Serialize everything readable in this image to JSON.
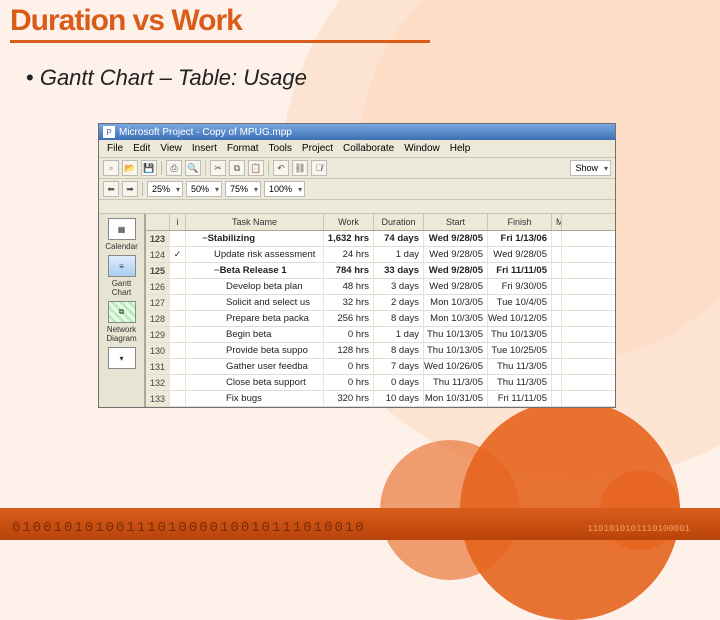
{
  "slide": {
    "title": "Duration vs Work",
    "bullet": "Gantt Chart – Table: Usage"
  },
  "app": {
    "title": "Microsoft Project - Copy of MPUG.mpp",
    "menu": [
      "File",
      "Edit",
      "View",
      "Insert",
      "Format",
      "Tools",
      "Project",
      "Collaborate",
      "Window",
      "Help"
    ],
    "zooms": [
      "25%",
      "50%",
      "75%",
      "100%"
    ],
    "show_label": "Show",
    "sidebar": [
      {
        "label": "Calendar"
      },
      {
        "label": "Gantt Chart"
      },
      {
        "label": "Network Diagram"
      }
    ],
    "columns": {
      "info": "i",
      "task": "Task Name",
      "work": "Work",
      "dur": "Duration",
      "start": "Start",
      "finish": "Finish",
      "m": "M"
    },
    "rows": [
      {
        "n": "123",
        "icon": "",
        "lvl": 1,
        "outline": true,
        "bold": true,
        "name": "Stabilizing",
        "work": "1,632 hrs",
        "dur": "74 days",
        "start": "Wed 9/28/05",
        "fin": "Fri 1/13/06"
      },
      {
        "n": "124",
        "icon": "✓",
        "lvl": 2,
        "name": "Update risk assessment",
        "work": "24 hrs",
        "dur": "1 day",
        "start": "Wed 9/28/05",
        "fin": "Wed 9/28/05"
      },
      {
        "n": "125",
        "icon": "",
        "lvl": 2,
        "outline": true,
        "bold": true,
        "name": "Beta Release 1",
        "work": "784 hrs",
        "dur": "33 days",
        "start": "Wed 9/28/05",
        "fin": "Fri 11/11/05"
      },
      {
        "n": "126",
        "icon": "",
        "lvl": 3,
        "name": "Develop beta plan",
        "work": "48 hrs",
        "dur": "3 days",
        "start": "Wed 9/28/05",
        "fin": "Fri 9/30/05"
      },
      {
        "n": "127",
        "icon": "",
        "lvl": 3,
        "name": "Solicit and select us",
        "work": "32 hrs",
        "dur": "2 days",
        "start": "Mon 10/3/05",
        "fin": "Tue 10/4/05"
      },
      {
        "n": "128",
        "icon": "",
        "lvl": 3,
        "name": "Prepare beta packa",
        "work": "256 hrs",
        "dur": "8 days",
        "start": "Mon 10/3/05",
        "fin": "Wed 10/12/05"
      },
      {
        "n": "129",
        "icon": "",
        "lvl": 3,
        "name": "Begin beta",
        "work": "0 hrs",
        "dur": "1 day",
        "start": "Thu 10/13/05",
        "fin": "Thu 10/13/05"
      },
      {
        "n": "130",
        "icon": "",
        "lvl": 3,
        "name": "Provide beta suppo",
        "work": "128 hrs",
        "dur": "8 days",
        "start": "Thu 10/13/05",
        "fin": "Tue 10/25/05"
      },
      {
        "n": "131",
        "icon": "",
        "lvl": 3,
        "name": "Gather user feedba",
        "work": "0 hrs",
        "dur": "7 days",
        "start": "Wed 10/26/05",
        "fin": "Thu 11/3/05"
      },
      {
        "n": "132",
        "icon": "",
        "lvl": 3,
        "name": "Close beta support",
        "work": "0 hrs",
        "dur": "0 days",
        "start": "Thu 11/3/05",
        "fin": "Thu 11/3/05"
      },
      {
        "n": "133",
        "icon": "",
        "lvl": 3,
        "name": "Fix bugs",
        "work": "320 hrs",
        "dur": "10 days",
        "start": "Mon 10/31/05",
        "fin": "Fri 11/11/05"
      }
    ]
  },
  "deco": {
    "bits": "0100101010011101000010010111010010",
    "bits2": "1101010101110100001"
  }
}
